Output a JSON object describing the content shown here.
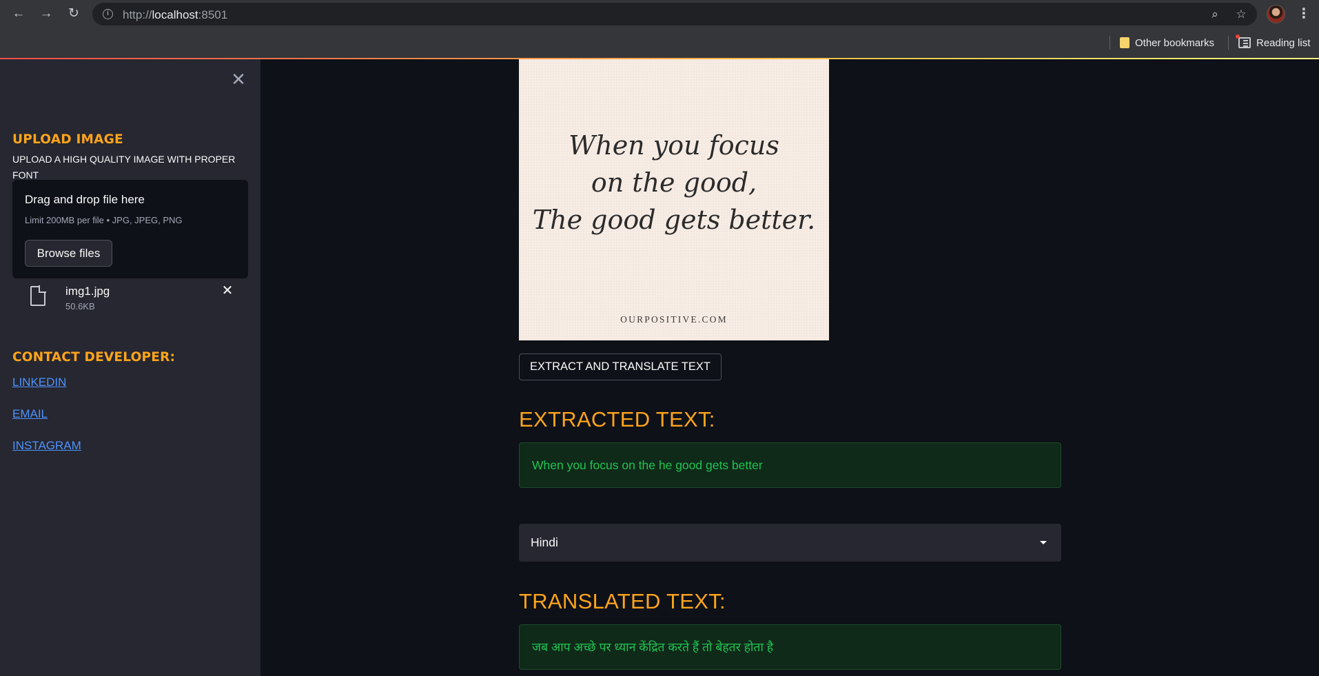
{
  "browser": {
    "url_scheme": "http://",
    "url_host": "localhost",
    "url_port": ":8501",
    "bookmarks": [
      "Other bookmarks",
      "Reading list"
    ]
  },
  "sidebar": {
    "close_icon": "close-icon",
    "upload_heading": "UPLOAD IMAGE",
    "upload_subtitle": "UPLOAD A HIGH QUALITY IMAGE WITH PROPER FONT",
    "dropzone_title": "Drag and drop file here",
    "dropzone_limit": "Limit 200MB per file • JPG, JPEG, PNG",
    "browse_label": "Browse files",
    "file": {
      "name": "img1.jpg",
      "size": "50.6KB"
    },
    "contact_heading": "CONTACT DEVELOPER:",
    "links": [
      "LINKEDIN",
      "EMAIL",
      "INSTAGRAM"
    ]
  },
  "main": {
    "image": {
      "quote_line1": "When you focus",
      "quote_line2": "on the good,",
      "quote_line3": "The good gets better.",
      "site": "OURPOSITIVE.COM"
    },
    "action_label": "EXTRACT AND TRANSLATE TEXT",
    "extracted_heading": "EXTRACTED TEXT:",
    "extracted_text": "When you focus on the he good gets better",
    "language": "Hindi",
    "translated_heading": "TRANSLATED TEXT:",
    "translated_text": "जब आप अच्छे पर ध्यान केंद्रित करते हैं तो बेहतर होता है"
  },
  "colors": {
    "accent_orange": "#ffa41c",
    "success_green": "#21c354",
    "link_blue": "#4e93ff",
    "sidebar_bg": "#262730",
    "main_bg": "#0e1117"
  }
}
